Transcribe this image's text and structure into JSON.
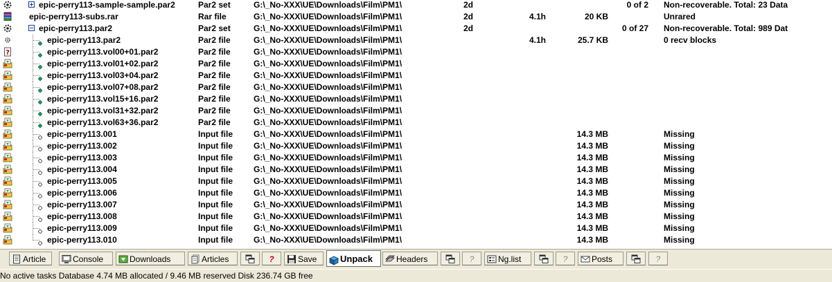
{
  "rows": [
    {
      "icon": "gear-icon",
      "kind": "set",
      "level": 0,
      "expander": "plus",
      "name": "epic-perry113-sample-sample.par2",
      "type": "Par2 set",
      "path": "G:\\_No-XXX\\UE\\Downloads\\Film\\PM1\\",
      "age": "2d",
      "time": "",
      "size": "",
      "parts": "0 of 2",
      "status": "Non-recoverable. Total: 23 Data"
    },
    {
      "icon": "rar-books-icon",
      "kind": "rar",
      "level": 0,
      "expander": "",
      "name": "epic-perry113-subs.rar",
      "type": "Rar file",
      "path": "G:\\_No-XXX\\UE\\Downloads\\Film\\PM1\\",
      "age": "2d",
      "time": "4.1h",
      "size": "20 KB",
      "parts": "",
      "status": "Unrared"
    },
    {
      "icon": "gear-icon",
      "kind": "set",
      "level": 0,
      "expander": "minus",
      "name": "epic-perry113.par2",
      "type": "Par2 set",
      "path": "G:\\_No-XXX\\UE\\Downloads\\Film\\PM1\\",
      "age": "2d",
      "time": "",
      "size": "",
      "parts": "0 of 27",
      "status": "Non-recoverable. Total: 989 Dat"
    },
    {
      "icon": "small-gear-icon",
      "kind": "par",
      "level": 1,
      "name": "epic-perry113.par2",
      "type": "Par2 file",
      "path": "G:\\_No-XXX\\UE\\Downloads\\Film\\PM1\\",
      "age": "",
      "time": "4.1h",
      "size": "25.7 KB",
      "parts": "",
      "status": "0 recv blocks"
    },
    {
      "icon": "page-question-icon",
      "kind": "par",
      "level": 1,
      "name": "epic-perry113.vol00+01.par2",
      "type": "Par2 file",
      "path": "G:\\_No-XXX\\UE\\Downloads\\Film\\PM1\\",
      "age": "",
      "time": "",
      "size": "",
      "parts": "",
      "status": ""
    },
    {
      "icon": "download-queue-icon",
      "kind": "par",
      "level": 1,
      "name": "epic-perry113.vol01+02.par2",
      "type": "Par2 file",
      "path": "G:\\_No-XXX\\UE\\Downloads\\Film\\PM1\\",
      "age": "",
      "time": "",
      "size": "",
      "parts": "",
      "status": ""
    },
    {
      "icon": "download-queue-icon",
      "kind": "par",
      "level": 1,
      "name": "epic-perry113.vol03+04.par2",
      "type": "Par2 file",
      "path": "G:\\_No-XXX\\UE\\Downloads\\Film\\PM1\\",
      "age": "",
      "time": "",
      "size": "",
      "parts": "",
      "status": ""
    },
    {
      "icon": "download-queue-icon",
      "kind": "par",
      "level": 1,
      "name": "epic-perry113.vol07+08.par2",
      "type": "Par2 file",
      "path": "G:\\_No-XXX\\UE\\Downloads\\Film\\PM1\\",
      "age": "",
      "time": "",
      "size": "",
      "parts": "",
      "status": ""
    },
    {
      "icon": "download-queue-icon",
      "kind": "par",
      "level": 1,
      "name": "epic-perry113.vol15+16.par2",
      "type": "Par2 file",
      "path": "G:\\_No-XXX\\UE\\Downloads\\Film\\PM1\\",
      "age": "",
      "time": "",
      "size": "",
      "parts": "",
      "status": ""
    },
    {
      "icon": "download-queue-icon",
      "kind": "par",
      "level": 1,
      "name": "epic-perry113.vol31+32.par2",
      "type": "Par2 file",
      "path": "G:\\_No-XXX\\UE\\Downloads\\Film\\PM1\\",
      "age": "",
      "time": "",
      "size": "",
      "parts": "",
      "status": ""
    },
    {
      "icon": "download-queue-icon",
      "kind": "par",
      "level": 1,
      "name": "epic-perry113.vol63+36.par2",
      "type": "Par2 file",
      "path": "G:\\_No-XXX\\UE\\Downloads\\Film\\PM1\\",
      "age": "",
      "time": "",
      "size": "",
      "parts": "",
      "status": ""
    },
    {
      "icon": "download-queue-icon",
      "kind": "input",
      "level": 1,
      "name": "epic-perry113.001",
      "type": "Input file",
      "path": "G:\\_No-XXX\\UE\\Downloads\\Film\\PM1\\",
      "age": "",
      "time": "",
      "size": "14.3 MB",
      "parts": "",
      "status": "Missing"
    },
    {
      "icon": "download-queue-icon",
      "kind": "input",
      "level": 1,
      "name": "epic-perry113.002",
      "type": "Input file",
      "path": "G:\\_No-XXX\\UE\\Downloads\\Film\\PM1\\",
      "age": "",
      "time": "",
      "size": "14.3 MB",
      "parts": "",
      "status": "Missing"
    },
    {
      "icon": "download-queue-icon",
      "kind": "input",
      "level": 1,
      "name": "epic-perry113.003",
      "type": "Input file",
      "path": "G:\\_No-XXX\\UE\\Downloads\\Film\\PM1\\",
      "age": "",
      "time": "",
      "size": "14.3 MB",
      "parts": "",
      "status": "Missing"
    },
    {
      "icon": "download-queue-icon",
      "kind": "input",
      "level": 1,
      "name": "epic-perry113.004",
      "type": "Input file",
      "path": "G:\\_No-XXX\\UE\\Downloads\\Film\\PM1\\",
      "age": "",
      "time": "",
      "size": "14.3 MB",
      "parts": "",
      "status": "Missing"
    },
    {
      "icon": "download-queue-icon",
      "kind": "input",
      "level": 1,
      "name": "epic-perry113.005",
      "type": "Input file",
      "path": "G:\\_No-XXX\\UE\\Downloads\\Film\\PM1\\",
      "age": "",
      "time": "",
      "size": "14.3 MB",
      "parts": "",
      "status": "Missing"
    },
    {
      "icon": "download-queue-icon",
      "kind": "input",
      "level": 1,
      "name": "epic-perry113.006",
      "type": "Input file",
      "path": "G:\\_No-XXX\\UE\\Downloads\\Film\\PM1\\",
      "age": "",
      "time": "",
      "size": "14.3 MB",
      "parts": "",
      "status": "Missing"
    },
    {
      "icon": "download-queue-icon",
      "kind": "input",
      "level": 1,
      "name": "epic-perry113.007",
      "type": "Input file",
      "path": "G:\\_No-XXX\\UE\\Downloads\\Film\\PM1\\",
      "age": "",
      "time": "",
      "size": "14.3 MB",
      "parts": "",
      "status": "Missing"
    },
    {
      "icon": "download-queue-icon",
      "kind": "input",
      "level": 1,
      "name": "epic-perry113.008",
      "type": "Input file",
      "path": "G:\\_No-XXX\\UE\\Downloads\\Film\\PM1\\",
      "age": "",
      "time": "",
      "size": "14.3 MB",
      "parts": "",
      "status": "Missing"
    },
    {
      "icon": "download-queue-icon",
      "kind": "input",
      "level": 1,
      "name": "epic-perry113.009",
      "type": "Input file",
      "path": "G:\\_No-XXX\\UE\\Downloads\\Film\\PM1\\",
      "age": "",
      "time": "",
      "size": "14.3 MB",
      "parts": "",
      "status": "Missing"
    },
    {
      "icon": "download-queue-icon",
      "kind": "input",
      "level": 1,
      "name": "epic-perry113.010",
      "type": "Input file",
      "path": "G:\\_No-XXX\\UE\\Downloads\\Film\\PM1\\",
      "age": "",
      "time": "",
      "size": "14.3 MB",
      "parts": "",
      "status": "Missing"
    }
  ],
  "tabs": [
    {
      "label": "Article",
      "icon": "article-page-icon",
      "active": false
    },
    {
      "label": "Console",
      "icon": "console-monitor-icon",
      "active": false
    },
    {
      "label": "Downloads",
      "icon": "downloads-icon",
      "active": false
    },
    {
      "label": "Articles",
      "icon": "articles-icon",
      "active": false
    },
    {
      "label": "",
      "icon": "cascade-windows-icon",
      "active": false
    },
    {
      "label": "",
      "icon": "help-question-icon",
      "active": false,
      "red": true
    },
    {
      "label": "Save",
      "icon": "floppy-disk-icon",
      "active": false
    },
    {
      "label": "Unpack",
      "icon": "unpack-box-icon",
      "active": true
    },
    {
      "label": "Headers",
      "icon": "headers-icon",
      "active": false
    },
    {
      "label": "",
      "icon": "cascade-windows-icon",
      "active": false
    },
    {
      "label": "",
      "icon": "help-question-icon",
      "active": false
    },
    {
      "label": "Ng.list",
      "icon": "newsgroup-list-icon",
      "active": false
    },
    {
      "label": "",
      "icon": "cascade-windows-icon",
      "active": false
    },
    {
      "label": "",
      "icon": "help-question-icon",
      "active": false
    },
    {
      "label": "Posts",
      "icon": "envelope-icon",
      "active": false
    },
    {
      "label": "",
      "icon": "cascade-windows-icon",
      "active": false
    },
    {
      "label": "",
      "icon": "help-question-icon",
      "active": false
    }
  ],
  "status": {
    "text": "No active tasks  Database 4.74 MB allocated / 9.46 MB reserved  Disk 236.74 GB free"
  }
}
